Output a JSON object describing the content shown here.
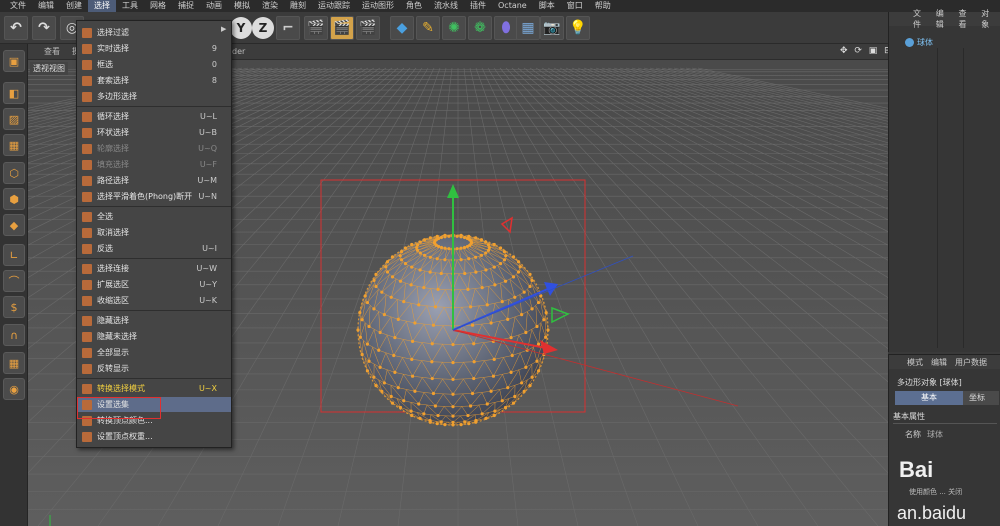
{
  "menubar": {
    "items": [
      "文件",
      "编辑",
      "创建",
      "选择",
      "工具",
      "网格",
      "捕捉",
      "动画",
      "模拟",
      "渲染",
      "雕刻",
      "运动跟踪",
      "运动图形",
      "角色",
      "流水线",
      "插件",
      "Octane",
      "脚本",
      "窗口",
      "帮助"
    ]
  },
  "viewport": {
    "header_menus": [
      "查看",
      "摄"
    ],
    "label": "透视视图",
    "partial_title": "der",
    "nav_icons": "✥ ⟳ ▣ ⊟"
  },
  "dropdown": {
    "items": [
      {
        "label": "选择过滤",
        "shortcut": "",
        "submenu": true
      },
      {
        "label": "实时选择",
        "shortcut": "9"
      },
      {
        "label": "框选",
        "shortcut": "0"
      },
      {
        "label": "套索选择",
        "shortcut": "8"
      },
      {
        "label": "多边形选择",
        "shortcut": ""
      },
      {
        "label": "循环选择",
        "shortcut": "U~L"
      },
      {
        "label": "环状选择",
        "shortcut": "U~B"
      },
      {
        "label": "轮廓选择",
        "shortcut": "U~Q",
        "disabled": true
      },
      {
        "label": "填充选择",
        "shortcut": "U~F",
        "disabled": true
      },
      {
        "label": "路径选择",
        "shortcut": "U~M"
      },
      {
        "label": "选择平滑着色(Phong)断开",
        "shortcut": "U~N"
      },
      {
        "label": "全选",
        "shortcut": ""
      },
      {
        "label": "取消选择",
        "shortcut": ""
      },
      {
        "label": "反选",
        "shortcut": "U~I"
      },
      {
        "label": "选择连接",
        "shortcut": "U~W"
      },
      {
        "label": "扩展选区",
        "shortcut": "U~Y"
      },
      {
        "label": "收缩选区",
        "shortcut": "U~K"
      },
      {
        "label": "隐藏选择",
        "shortcut": ""
      },
      {
        "label": "隐藏未选择",
        "shortcut": ""
      },
      {
        "label": "全部显示",
        "shortcut": ""
      },
      {
        "label": "反转显示",
        "shortcut": ""
      },
      {
        "label": "转换选择模式",
        "shortcut": "U~X",
        "yellow": true
      },
      {
        "label": "设置选集",
        "shortcut": "",
        "selected": true
      },
      {
        "label": "转换顶点颜色...",
        "shortcut": ""
      },
      {
        "label": "设置顶点权重...",
        "shortcut": ""
      }
    ]
  },
  "object_manager": {
    "menus": [
      "文件",
      "编辑",
      "查看",
      "对象"
    ],
    "object_name": "球体"
  },
  "attributes": {
    "menus": [
      "模式",
      "编辑",
      "用户数据"
    ],
    "object_title": "多边形对象 [球体]",
    "tab_basic": "基本",
    "tab_coord": "坐标",
    "section": "基本属性",
    "name_label": "名称",
    "name_value": "球体",
    "small_labels": "使用颜色 ... 关闭"
  },
  "watermark": {
    "line1": "Bai",
    "line2": "an.baidu"
  },
  "colors": {
    "accent": "#5e6c8a",
    "sphere_points": "#f0a030",
    "axis_x": "#e03030",
    "axis_y": "#30c040",
    "axis_z": "#3050e0",
    "bounding_box": "#d83030"
  }
}
